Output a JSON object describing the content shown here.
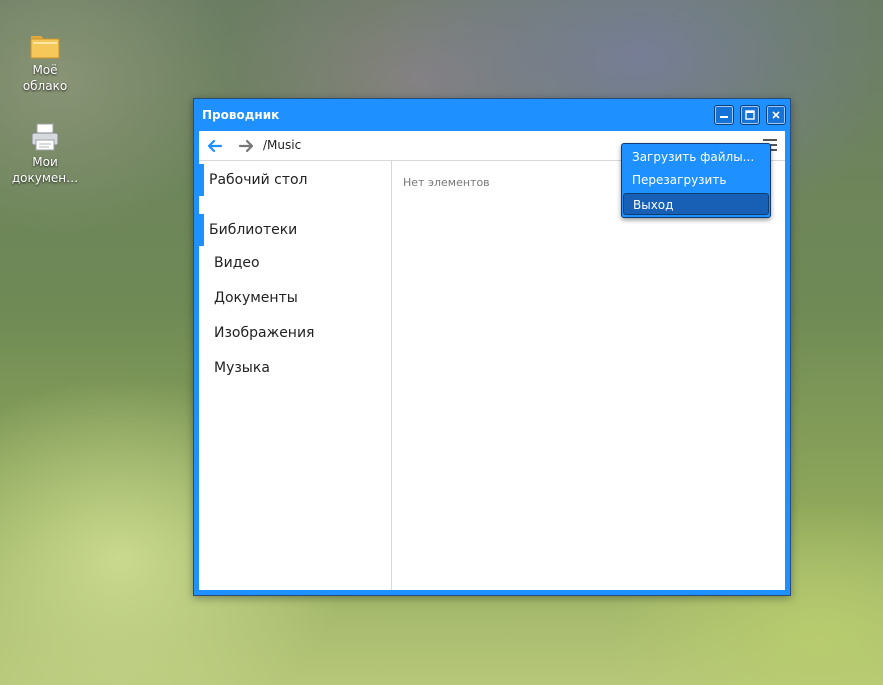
{
  "desktop": {
    "icons": [
      {
        "label": "Моё\nоблако",
        "icon": "folder-icon"
      },
      {
        "label": "Мои\nдокумен…",
        "icon": "printer-icon"
      }
    ]
  },
  "window": {
    "title": "Проводник",
    "controls": [
      "minimize",
      "maximize",
      "close"
    ],
    "toolbar": {
      "back_icon": "arrow-left-icon",
      "forward_icon": "arrow-right-icon",
      "path": "/Music",
      "menu_icon": "hamburger-menu-icon"
    },
    "sidebar": {
      "desktop_label": "Рабочий стол",
      "libraries_label": "Библиотеки",
      "items": [
        "Видео",
        "Документы",
        "Изображения",
        "Музыка"
      ]
    },
    "content": {
      "empty_text": "Нет элементов"
    }
  },
  "popup_menu": {
    "items": [
      "Загрузить файлы...",
      "Перезагрузить",
      "Выход"
    ],
    "highlighted": "Выход"
  },
  "colors": {
    "accent": "#1e90ff",
    "menu_highlight": "#1860b5",
    "arrow_active": "#1e90ff",
    "arrow_inactive": "#777777"
  }
}
